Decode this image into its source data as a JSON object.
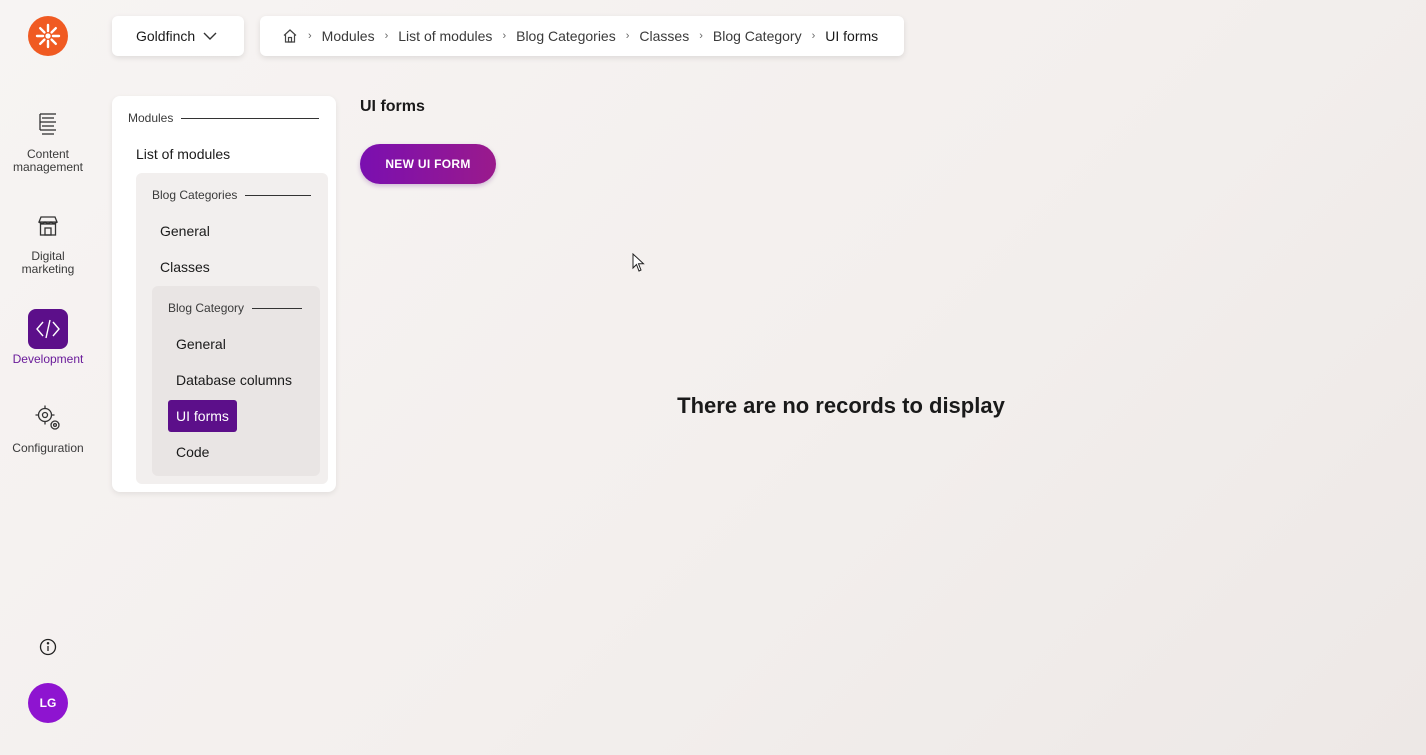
{
  "rail": {
    "items": [
      {
        "label_line1": "Content",
        "label_line2": "management",
        "icon": "content-management-icon"
      },
      {
        "label_line1": "Digital",
        "label_line2": "marketing",
        "icon": "storefront-icon"
      },
      {
        "label_line1": "Development",
        "label_line2": "",
        "icon": "code-icon"
      },
      {
        "label_line1": "Configuration",
        "label_line2": "",
        "icon": "gears-icon"
      }
    ],
    "avatar_initials": "LG",
    "logo_color": "#f05a22",
    "accent_color": "#5c0f8a"
  },
  "site_selector": {
    "value": "Goldfinch"
  },
  "breadcrumb": {
    "items": [
      "Modules",
      "List of modules",
      "Blog Categories",
      "Classes",
      "Blog Category",
      "UI forms"
    ]
  },
  "side_panel": {
    "modules_heading": "Modules",
    "list_of_modules": "List of modules",
    "blog_categories_heading": "Blog Categories",
    "blog_categories_items": [
      "General",
      "Classes"
    ],
    "blog_category_heading": "Blog Category",
    "blog_category_items": [
      "General",
      "Database columns",
      "UI forms",
      "Code"
    ],
    "active_item": "UI forms"
  },
  "main": {
    "title": "UI forms",
    "new_button_label": "NEW UI FORM",
    "empty_message": "There are no records to display"
  }
}
